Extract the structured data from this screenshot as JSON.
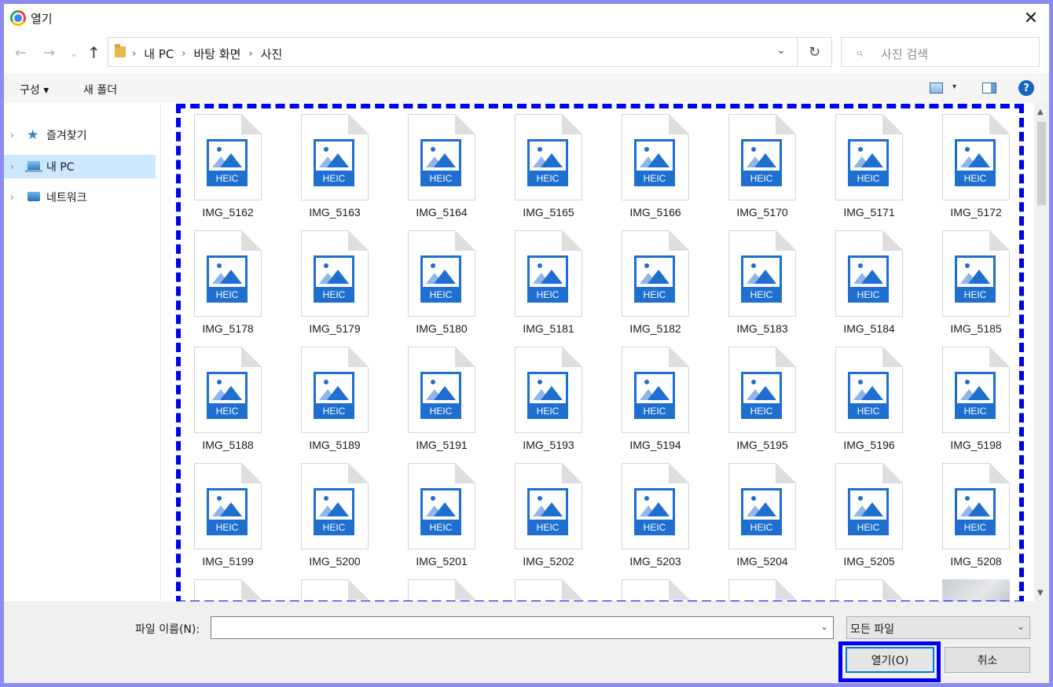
{
  "window": {
    "title": "열기",
    "close_icon": "✕"
  },
  "nav": {
    "back_icon": "←",
    "forward_icon": "→",
    "recent_icon": "⌄",
    "up_icon": "↑",
    "breadcrumbs": [
      "내 PC",
      "바탕 화면",
      "사진"
    ],
    "separator": "›",
    "dropdown_icon": "⌄",
    "refresh_icon": "↻",
    "search_placeholder": "사진 검색",
    "search_icon": "⌕"
  },
  "toolbar": {
    "organize": "구성 ▾",
    "new_folder": "새 폴더",
    "help": "?",
    "view_caret": "▾"
  },
  "sidebar": {
    "items": [
      {
        "label": "즐겨찾기",
        "icon": "star-icon",
        "selected": false
      },
      {
        "label": "내 PC",
        "icon": "pc-icon",
        "selected": true
      },
      {
        "label": "네트워크",
        "icon": "network-icon",
        "selected": false
      }
    ],
    "chevron": "›"
  },
  "files": {
    "type_label": "HEIC",
    "rows": [
      [
        "IMG_5162",
        "IMG_5163",
        "IMG_5164",
        "IMG_5165",
        "IMG_5166",
        "IMG_5170",
        "IMG_5171",
        "IMG_5172"
      ],
      [
        "IMG_5178",
        "IMG_5179",
        "IMG_5180",
        "IMG_5181",
        "IMG_5182",
        "IMG_5183",
        "IMG_5184",
        "IMG_5185"
      ],
      [
        "IMG_5188",
        "IMG_5189",
        "IMG_5191",
        "IMG_5193",
        "IMG_5194",
        "IMG_5195",
        "IMG_5196",
        "IMG_5198"
      ],
      [
        "IMG_5199",
        "IMG_5200",
        "IMG_5201",
        "IMG_5202",
        "IMG_5203",
        "IMG_5204",
        "IMG_5205",
        "IMG_5208"
      ]
    ]
  },
  "scrollbar": {
    "up_icon": "▲",
    "down_icon": "▼"
  },
  "footer": {
    "filename_label": "파일 이름(N):",
    "filename_value": "",
    "filetype_value": "모든 파일",
    "caret": "⌄",
    "open_label": "열기(O)",
    "cancel_label": "취소"
  },
  "colors": {
    "highlight": "#0000ee",
    "heic_blue": "#1f6fd1",
    "selected_bg": "#cce8ff"
  }
}
